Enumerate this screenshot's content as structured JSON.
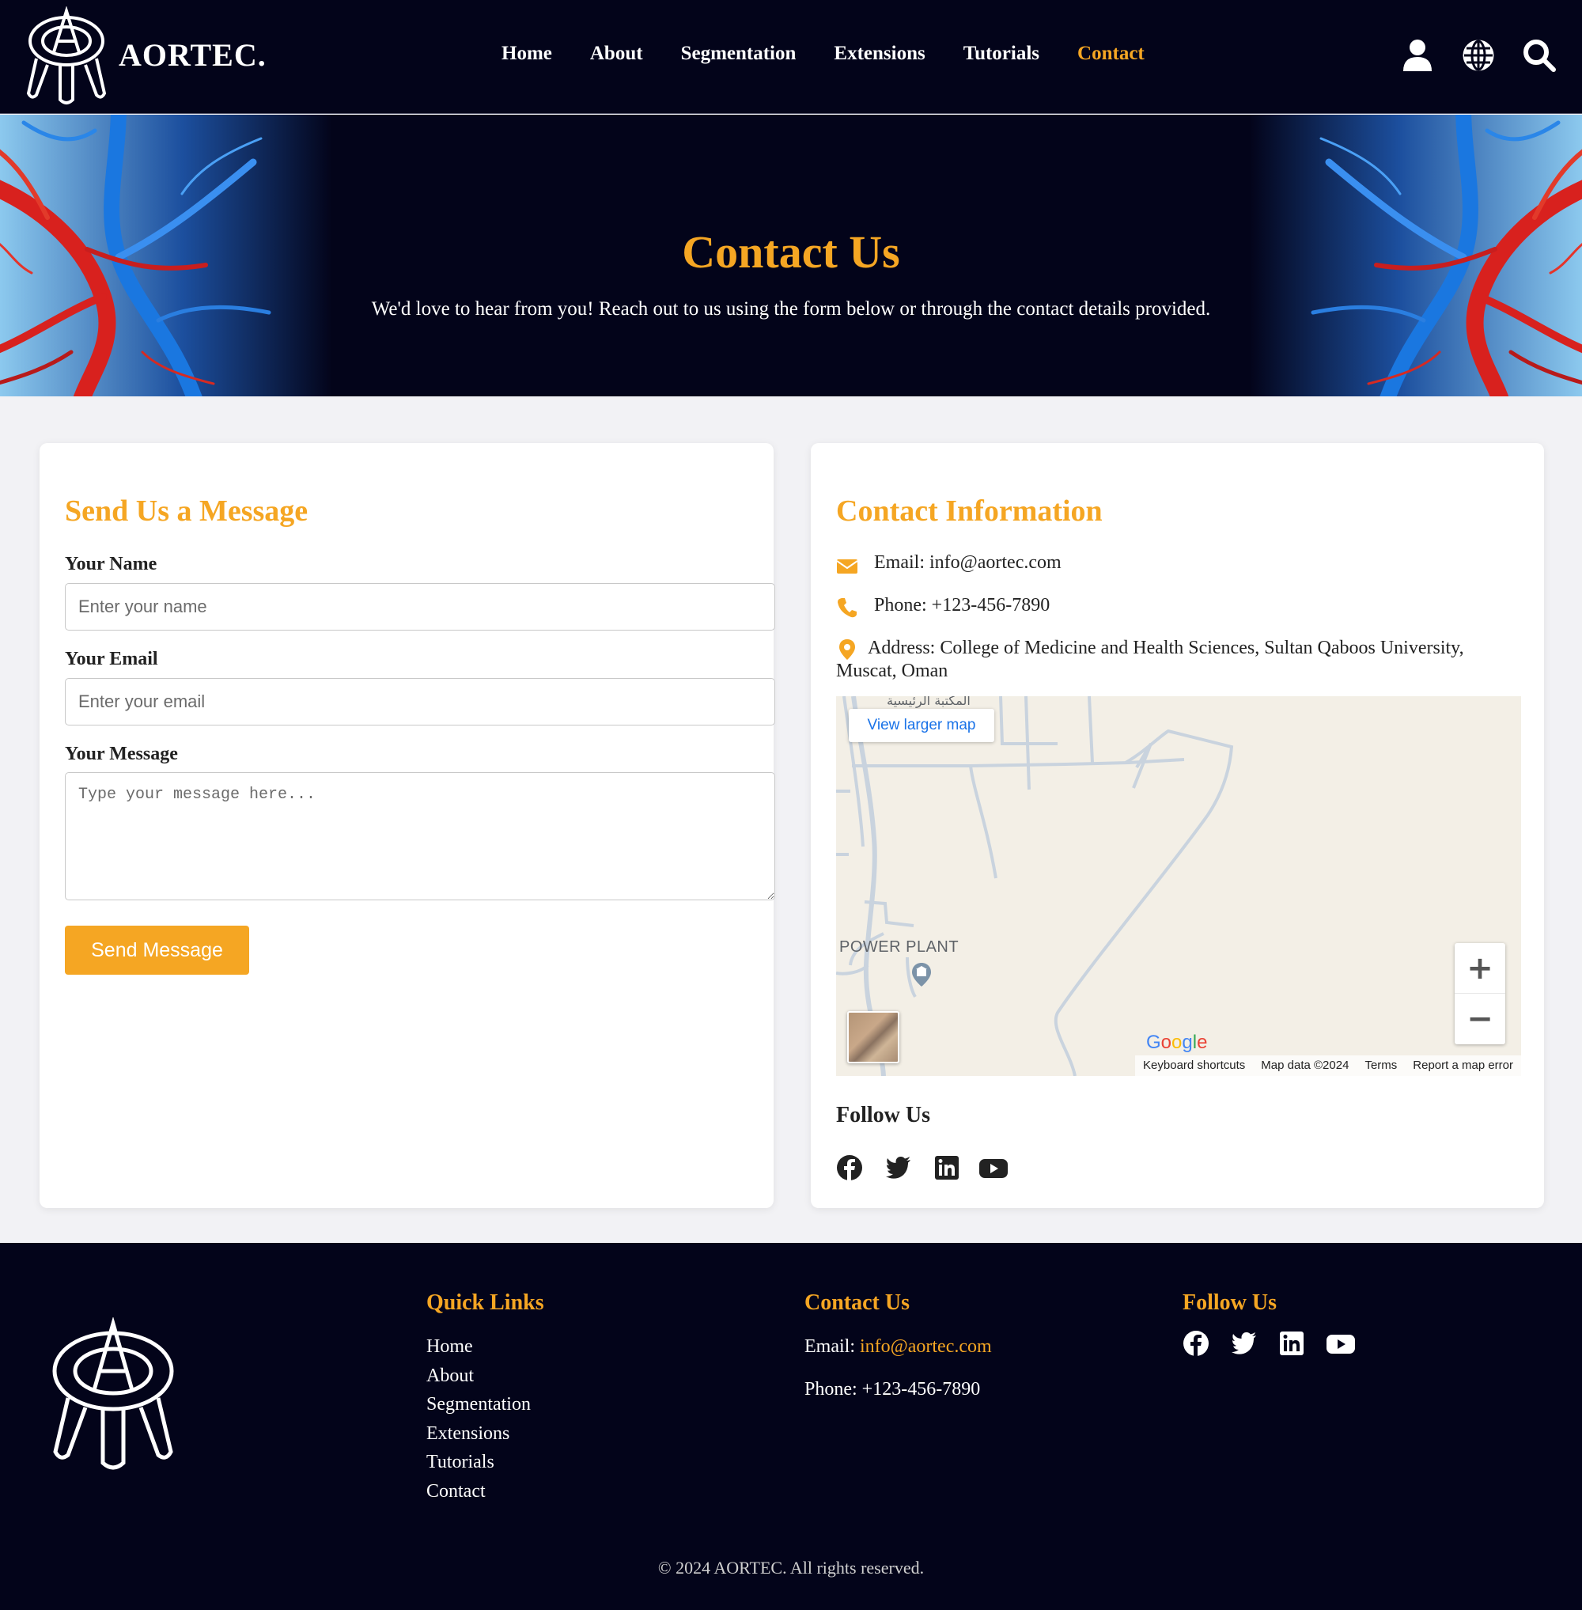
{
  "header": {
    "brand": "AORTEC.",
    "nav": [
      "Home",
      "About",
      "Segmentation",
      "Extensions",
      "Tutorials",
      "Contact"
    ],
    "active_nav": "Contact",
    "icons": [
      "user-icon",
      "globe-icon",
      "search-icon"
    ]
  },
  "hero": {
    "title": "Contact Us",
    "subtitle": "We'd love to hear from you! Reach out to us using the form below or through the contact details provided."
  },
  "form": {
    "title": "Send Us a Message",
    "name_label": "Your Name",
    "name_placeholder": "Enter your name",
    "email_label": "Your Email",
    "email_placeholder": "Enter your email",
    "message_label": "Your Message",
    "message_placeholder": "Type your message here...",
    "submit_label": "Send Message"
  },
  "contact": {
    "title": "Contact Information",
    "email": "Email: info@aortec.com",
    "phone": "Phone: +123-456-7890",
    "address_line1": "Address: College of Medicine and Health Sciences, Sultan Qaboos University,",
    "address_line2": "Muscat, Oman",
    "map": {
      "view_larger": "View larger map",
      "place_label": "POWER PLANT",
      "arabic_label": "المكتبة الرئيسية",
      "google": "Google",
      "footer": [
        "Keyboard shortcuts",
        "Map data ©2024",
        "Terms",
        "Report a map error"
      ],
      "zoom_in": "+",
      "zoom_out": "−"
    },
    "follow_title": "Follow Us",
    "social": [
      "facebook-icon",
      "twitter-icon",
      "linkedin-icon",
      "youtube-icon"
    ]
  },
  "footer": {
    "quick_links_title": "Quick Links",
    "quick_links": [
      "Home",
      "About",
      "Segmentation",
      "Extensions",
      "Tutorials",
      "Contact"
    ],
    "contact_title": "Contact Us",
    "email_label": "Email: ",
    "email_value": "info@aortec.com",
    "phone": "Phone: +123-456-7890",
    "follow_title": "Follow Us",
    "copyright": "© 2024 AORTEC. All rights reserved."
  },
  "colors": {
    "accent": "#f5a623",
    "navy": "#03041a",
    "background": "#f2f2f5"
  }
}
